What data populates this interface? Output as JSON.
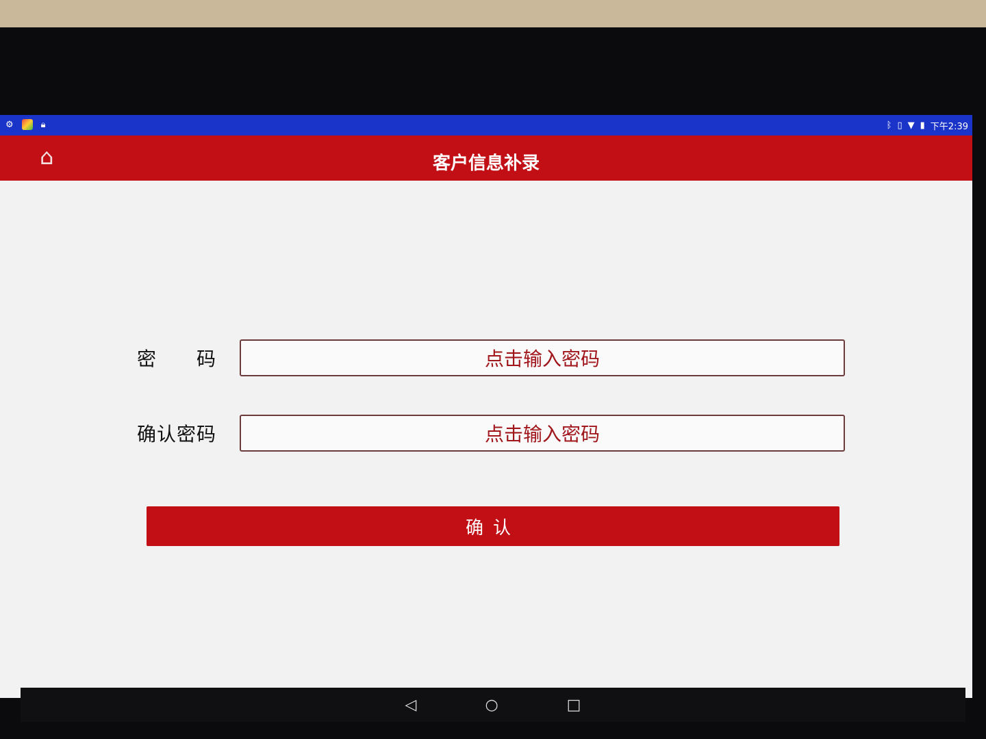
{
  "status_bar": {
    "time": "下午2:39",
    "icons_left": [
      "notification-icon",
      "app-icon",
      "lock-icon"
    ],
    "icons_right": [
      "bluetooth-icon",
      "vibrate-icon",
      "wifi-icon",
      "signal-icon",
      "battery-icon"
    ]
  },
  "header": {
    "title": "客户信息补录",
    "home_icon": "home-icon"
  },
  "form": {
    "password_label": "密　　码",
    "password_placeholder": "点击输入密码",
    "confirm_password_label": "确认密码",
    "confirm_password_placeholder": "点击输入密码",
    "confirm_button": "确认"
  },
  "nav": {
    "back": "◁",
    "home": "○",
    "recents": "□"
  },
  "colors": {
    "header": "#c20f16",
    "status_bar": "#1a33c8",
    "placeholder": "#a0161b"
  }
}
